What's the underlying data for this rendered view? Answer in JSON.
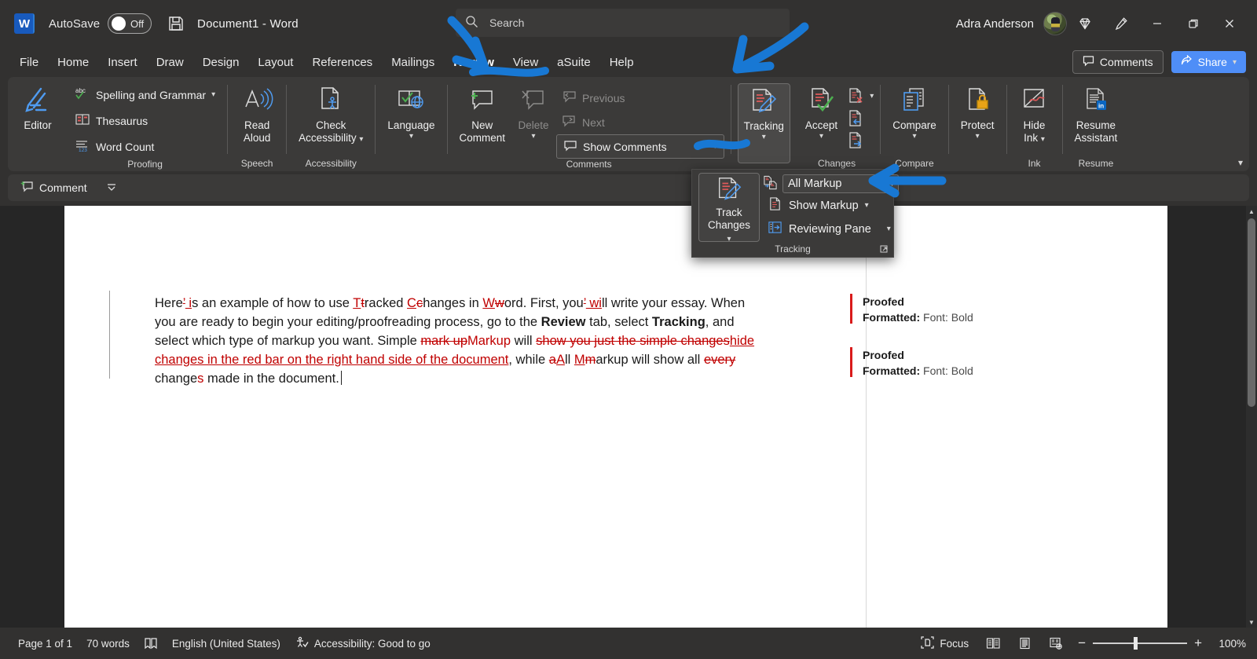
{
  "titlebar": {
    "logo": "word-logo",
    "autosave_label": "AutoSave",
    "autosave_state": "Off",
    "save_icon": "save-icon",
    "document_title": "Document1  -  Word",
    "search_placeholder": "Search",
    "search_icon": "search-icon",
    "user_name": "Adra Anderson",
    "avatar": "user-avatar",
    "diamond_icon": "diamond-icon",
    "pen_icon": "pen-icon",
    "minimize": "—",
    "restore": "❐",
    "close": "✕"
  },
  "tabs": [
    {
      "label": "File",
      "active": false
    },
    {
      "label": "Home",
      "active": false
    },
    {
      "label": "Insert",
      "active": false
    },
    {
      "label": "Draw",
      "active": false
    },
    {
      "label": "Design",
      "active": false
    },
    {
      "label": "Layout",
      "active": false
    },
    {
      "label": "References",
      "active": false
    },
    {
      "label": "Mailings",
      "active": false
    },
    {
      "label": "Review",
      "active": true
    },
    {
      "label": "View",
      "active": false
    },
    {
      "label": "aSuite",
      "active": false
    },
    {
      "label": "Help",
      "active": false
    }
  ],
  "tabrow_right": {
    "comments_label": "Comments",
    "share_label": "Share"
  },
  "ribbon": {
    "editor_label": "Editor",
    "proofing": {
      "group_label": "Proofing",
      "spelling_label": "Spelling and Grammar",
      "thesaurus_label": "Thesaurus",
      "wordcount_label": "Word Count"
    },
    "speech": {
      "group_label": "Speech",
      "read_aloud_line1": "Read",
      "read_aloud_line2": "Aloud"
    },
    "accessibility": {
      "group_label": "Accessibility",
      "check_line1": "Check",
      "check_line2": "Accessibility"
    },
    "language": {
      "group_label": "",
      "label": "Language"
    },
    "comments": {
      "group_label": "Comments",
      "new_comment_line1": "New",
      "new_comment_line2": "Comment",
      "delete_label": "Delete",
      "previous_label": "Previous",
      "next_label": "Next",
      "show_comments_label": "Show Comments"
    },
    "tracking": {
      "group_label": "",
      "label": "Tracking"
    },
    "changes": {
      "group_label": "Changes",
      "accept_label": "Accept",
      "reject_icon": "reject-change-icon",
      "previous_change_icon": "previous-change-icon",
      "next_change_icon": "next-change-icon"
    },
    "compare": {
      "group_label": "Compare",
      "label": "Compare"
    },
    "protect": {
      "group_label": "",
      "label": "Protect"
    },
    "ink": {
      "group_label": "Ink",
      "line1": "Hide",
      "line2": "Ink"
    },
    "resume": {
      "group_label": "Resume",
      "line1": "Resume",
      "line2": "Assistant"
    },
    "collapse_icon": "chevron-up-icon"
  },
  "tracking_panel": {
    "track_changes_line1": "Track",
    "track_changes_line2": "Changes",
    "all_markup_label": "All Markup",
    "show_markup_label": "Show Markup",
    "reviewing_pane_label": "Reviewing Pane",
    "group_label": "Tracking",
    "dialog_launcher": "dialog-box-launcher-icon"
  },
  "comment_bar": {
    "comment_label": "Comment",
    "expand_icon": "chevron-double-down-icon"
  },
  "document": {
    "paragraph": [
      {
        "t": "Here",
        "s": "normal"
      },
      {
        "t": "’",
        "s": "del"
      },
      {
        "t": " i",
        "s": "ins"
      },
      {
        "t": "s an example of how to use ",
        "s": "normal"
      },
      {
        "t": "T",
        "s": "ins"
      },
      {
        "t": "t",
        "s": "del"
      },
      {
        "t": "racked ",
        "s": "normal"
      },
      {
        "t": "C",
        "s": "ins"
      },
      {
        "t": "c",
        "s": "del"
      },
      {
        "t": "hanges in ",
        "s": "normal"
      },
      {
        "t": "W",
        "s": "ins"
      },
      {
        "t": "w",
        "s": "del"
      },
      {
        "t": "ord. First, you",
        "s": "normal"
      },
      {
        "t": "’",
        "s": "del"
      },
      {
        "t": " wi",
        "s": "ins"
      },
      {
        "t": "ll write your essay. When you are ready to begin your editing/proofreading process, go to the ",
        "s": "normal"
      },
      {
        "t": "Review",
        "s": "bold"
      },
      {
        "t": " tab, select ",
        "s": "normal"
      },
      {
        "t": "Tracking",
        "s": "bold"
      },
      {
        "t": ", and select which type of markup you want. Simple ",
        "s": "normal"
      },
      {
        "t": "mark up",
        "s": "del"
      },
      {
        "t": "Markup",
        "s": "insp"
      },
      {
        "t": " will ",
        "s": "normal"
      },
      {
        "t": "show you just the simple changes",
        "s": "del"
      },
      {
        "t": "hide changes in the red bar on the right hand side of the document",
        "s": "ins"
      },
      {
        "t": ", while ",
        "s": "normal"
      },
      {
        "t": "a",
        "s": "del"
      },
      {
        "t": "A",
        "s": "ins"
      },
      {
        "t": "ll ",
        "s": "normal"
      },
      {
        "t": "M",
        "s": "ins"
      },
      {
        "t": "m",
        "s": "del"
      },
      {
        "t": "arkup will show all ",
        "s": "normal"
      },
      {
        "t": "every ",
        "s": "del"
      },
      {
        "t": "change",
        "s": "normal"
      },
      {
        "t": "s",
        "s": "insp"
      },
      {
        "t": " made in the document.",
        "s": "normal"
      }
    ]
  },
  "markup_pane": [
    {
      "title": "Proofed",
      "label": "Formatted:",
      "value": " Font: Bold"
    },
    {
      "title": "Proofed",
      "label": "Formatted:",
      "value": " Font: Bold"
    }
  ],
  "statusbar": {
    "page_label": "Page 1 of 1",
    "word_count": "70 words",
    "proofing_icon": "proofing-status-icon",
    "language": "English (United States)",
    "accessibility_icon": "accessibility-icon",
    "accessibility_label": "Accessibility: Good to go",
    "focus_label": "Focus",
    "focus_icon": "focus-icon",
    "read_mode_icon": "read-mode-icon",
    "print_layout_icon": "print-layout-icon",
    "web_layout_icon": "web-layout-icon",
    "zoom_out": "−",
    "zoom_in": "+",
    "zoom_level": "100%"
  },
  "colors": {
    "accent_blue": "#4f8ef7",
    "annotation_blue": "#1878d4",
    "tracked_change_red": "#c00000",
    "markup_bar_red": "#d91b1b",
    "chrome_dark": "#323130",
    "ribbon_bg": "#3b3a39"
  }
}
